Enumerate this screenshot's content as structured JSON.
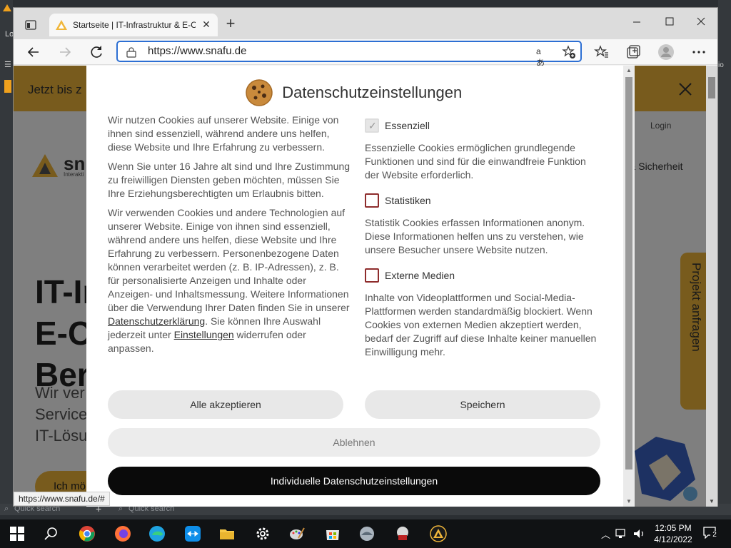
{
  "browser": {
    "tab_title": "Startseite | IT-Infrastruktur & E-Commerce",
    "new_tab_label": "+",
    "url": "https://www.snafu.de",
    "status_url": "https://www.snafu.de/#",
    "read_aloud_icon": "aあ"
  },
  "page": {
    "banner_text": "Jetzt bis z",
    "logo_text": "sn",
    "logo_sub": "Interakti",
    "nav_login": "Login",
    "nav_security": "& Sicherheit",
    "hero_lines": [
      "IT-In",
      "E-Co",
      "Berl"
    ],
    "hero_sub_lines": [
      "Wir ver",
      "Service",
      "IT-Lösu"
    ],
    "hero_button": "Ich mö",
    "project_tab": "Projekt anfragen"
  },
  "dialog": {
    "title": "Datenschutzeinstellungen",
    "paragraph1": "Wir nutzen Cookies auf unserer Website. Einige von ihnen sind essenziell, während andere uns helfen, diese Website und Ihre Erfahrung zu verbessern.",
    "paragraph2": "Wenn Sie unter 16 Jahre alt sind und Ihre Zustimmung zu freiwilligen Diensten geben möchten, müssen Sie Ihre Erziehungsberechtigten um Erlaubnis bitten.",
    "paragraph3_a": "Wir verwenden Cookies und andere Technologien auf unserer Website. Einige von ihnen sind essenziell, während andere uns helfen, diese Website und Ihre Erfahrung zu verbessern. Personenbezogene Daten können verarbeitet werden (z. B. IP-Adressen), z. B. für personalisierte Anzeigen und Inhalte oder Anzeigen- und Inhaltsmessung. Weitere Informationen über die Verwendung Ihrer Daten finden Sie in unserer ",
    "privacy_link": "Datenschutzerklärung",
    "paragraph3_b": ". Sie können Ihre Auswahl jederzeit unter ",
    "settings_link": "Einstellungen",
    "paragraph3_c": " widerrufen oder anpassen.",
    "options": [
      {
        "label": "Essenziell",
        "checked": true,
        "description": "Essenzielle Cookies ermöglichen grundlegende Funktionen und sind für die einwandfreie Funktion der Website erforderlich."
      },
      {
        "label": "Statistiken",
        "checked": false,
        "description": "Statistik Cookies erfassen Informationen anonym. Diese Informationen helfen uns zu verstehen, wie unsere Besucher unsere Website nutzen."
      },
      {
        "label": "Externe Medien",
        "checked": false,
        "description": "Inhalte von Videoplattformen und Social-Media-Plattformen werden standardmäßig blockiert. Wenn Cookies von externen Medien akzeptiert werden, bedarf der Zugriff auf diese Inhalte keiner manuellen Einwilligung mehr."
      }
    ],
    "buttons": {
      "accept_all": "Alle akzeptieren",
      "save": "Speichern",
      "reject": "Ablehnen",
      "individual": "Individuelle Datenschutzeinstellungen"
    }
  },
  "desktop": {
    "left_tab": "Lo",
    "right_text": "io",
    "quick_search_1": "Quick search",
    "quick_search_2": "Quick search"
  },
  "taskbar": {
    "time": "12:05 PM",
    "date": "4/12/2022",
    "notification_count": "2"
  },
  "colors": {
    "accent_yellow": "#f0b63a",
    "checkbox_border": "#8e2c2c",
    "address_focus": "#2d6fd3",
    "primary_button": "#0a0a0a"
  }
}
